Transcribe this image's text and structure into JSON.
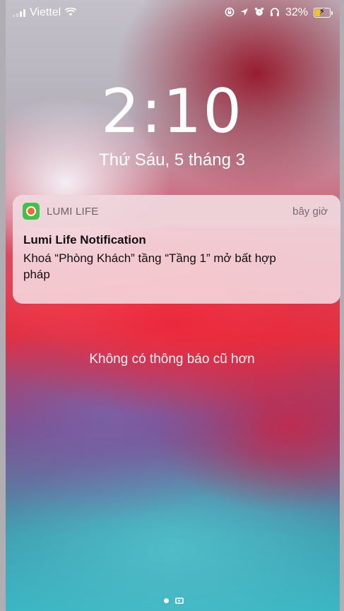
{
  "status_bar": {
    "carrier": "Viettel",
    "battery_percent": "32%",
    "battery_level": 0.32,
    "icons": [
      "signal-icon",
      "wifi-icon",
      "screen-lock-icon",
      "location-icon",
      "alarm-icon",
      "headphones-icon",
      "battery-charging-icon"
    ]
  },
  "lock_screen": {
    "time": "2:10",
    "date": "Thứ Sáu, 5 tháng 3"
  },
  "notification": {
    "app_name": "LUMI LIFE",
    "time": "bây giờ",
    "title": "Lumi Life Notification",
    "body": "Khoá “Phòng Khách” tầng “Tầng 1” mở bất hợp pháp",
    "icon": "lumi-life-app-icon",
    "app_color": "#3ec24a"
  },
  "footer": {
    "no_older_text": "Không có thông báo cũ hơn"
  },
  "page_indicator": {
    "items": [
      "dot",
      "camera-icon"
    ]
  }
}
